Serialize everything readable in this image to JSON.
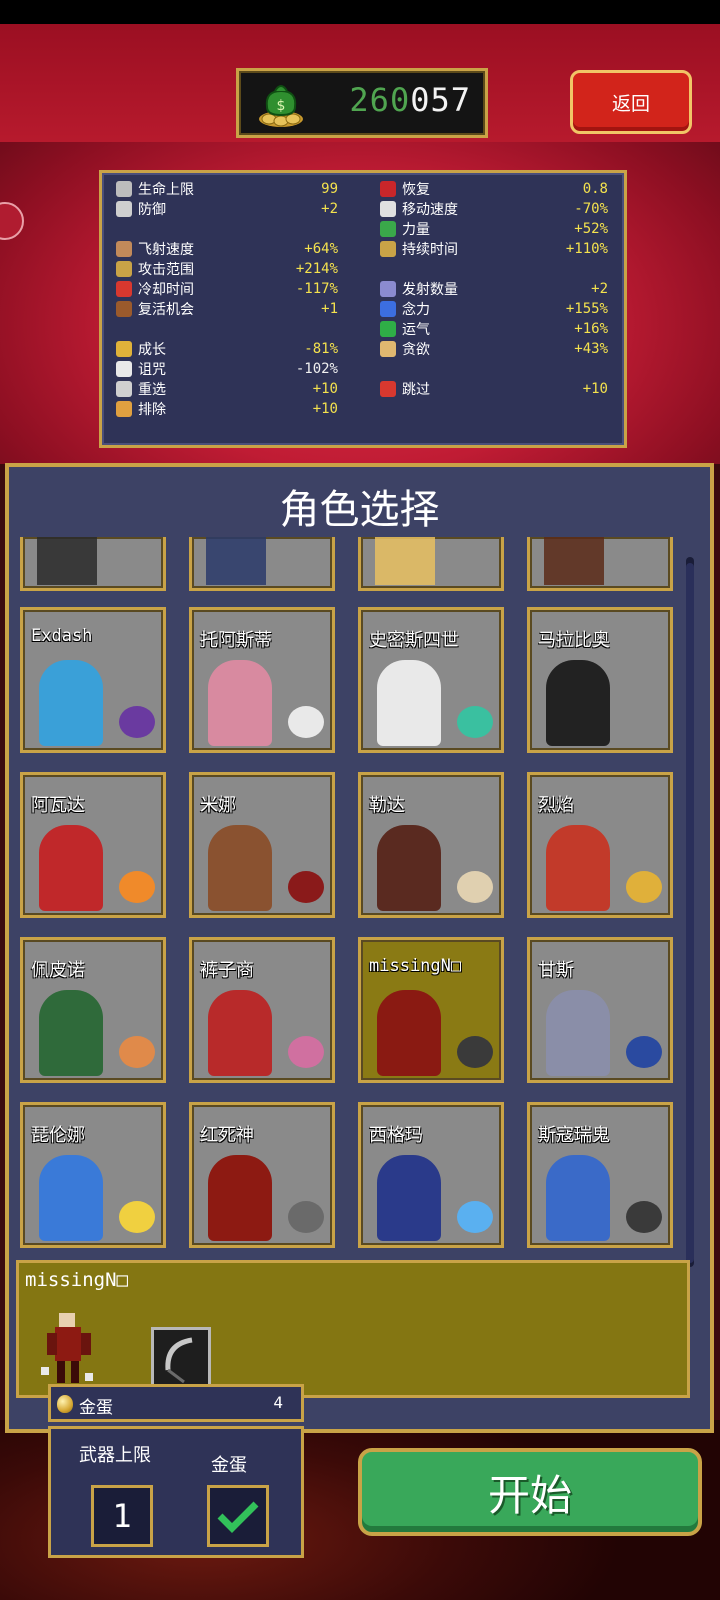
{
  "header": {
    "coins_overlap": "260",
    "coins_value": "057",
    "back_label": "返回"
  },
  "stats": {
    "left": [
      {
        "icon": "heart-outline-icon",
        "label": "生命上限",
        "value": "99",
        "white": false
      },
      {
        "icon": "shield-icon",
        "label": "防御",
        "value": "+2",
        "white": false
      },
      {
        "icon": "sword-arm-icon",
        "label": "飞射速度",
        "value": "+64%",
        "white": false
      },
      {
        "icon": "area-icon",
        "label": "攻击范围",
        "value": "+214%",
        "white": false
      },
      {
        "icon": "hourglass-icon",
        "label": "冷却时间",
        "value": "-117%",
        "white": false
      },
      {
        "icon": "revival-icon",
        "label": "复活机会",
        "value": "+1",
        "white": false
      },
      {
        "icon": "crown-icon",
        "label": "成长",
        "value": "-81%",
        "white": false
      },
      {
        "icon": "skull-icon",
        "label": "诅咒",
        "value": "-102%",
        "white": true
      },
      {
        "icon": "reroll-icon",
        "label": "重选",
        "value": "+10",
        "white": false
      },
      {
        "icon": "banish-icon",
        "label": "排除",
        "value": "+10",
        "white": false
      }
    ],
    "right": [
      {
        "icon": "heart-recovery-icon",
        "label": "恢复",
        "value": "0.8",
        "white": false
      },
      {
        "icon": "wing-icon",
        "label": "移动速度",
        "value": "-70%",
        "white": false
      },
      {
        "icon": "leaf-icon",
        "label": "力量",
        "value": "+52%",
        "white": false
      },
      {
        "icon": "duration-icon",
        "label": "持续时间",
        "value": "+110%",
        "white": false
      },
      {
        "icon": "amount-icon",
        "label": "发射数量",
        "value": "+2",
        "white": false
      },
      {
        "icon": "orb-icon",
        "label": "念力",
        "value": "+155%",
        "white": false
      },
      {
        "icon": "clover-icon",
        "label": "运气",
        "value": "+16%",
        "white": false
      },
      {
        "icon": "greed-icon",
        "label": "贪欲",
        "value": "+43%",
        "white": false
      },
      {
        "icon": "skip-icon",
        "label": "跳过",
        "value": "+10",
        "white": false
      }
    ]
  },
  "panel": {
    "title": "角色选择",
    "cards": [
      {
        "name": "Exdash"
      },
      {
        "name": "托阿斯蒂"
      },
      {
        "name": "史密斯四世"
      },
      {
        "name": "马拉比奥"
      },
      {
        "name": "阿瓦达"
      },
      {
        "name": "米娜"
      },
      {
        "name": "勒达"
      },
      {
        "name": "烈焰"
      },
      {
        "name": "佩皮诺"
      },
      {
        "name": "裤子商"
      },
      {
        "name": "missingN□"
      },
      {
        "name": "甘斯"
      },
      {
        "name": "琵伦娜"
      },
      {
        "name": "红死神"
      },
      {
        "name": "西格玛"
      },
      {
        "name": "斯寇瑞鬼"
      }
    ]
  },
  "detail": {
    "name": "missingN□"
  },
  "options": {
    "egg_label": "金蛋",
    "egg_count": "4",
    "weapon_limit_label": "武器上限",
    "weapon_limit_value": "1",
    "golden_egg_label": "金蛋"
  },
  "start_label": "开始",
  "colors": {
    "gold_border": "#c9a347",
    "panel_bg": "#3d4265",
    "stat_value": "#f4e24e",
    "start_green": "#39a85a",
    "back_red": "#d2241b"
  }
}
